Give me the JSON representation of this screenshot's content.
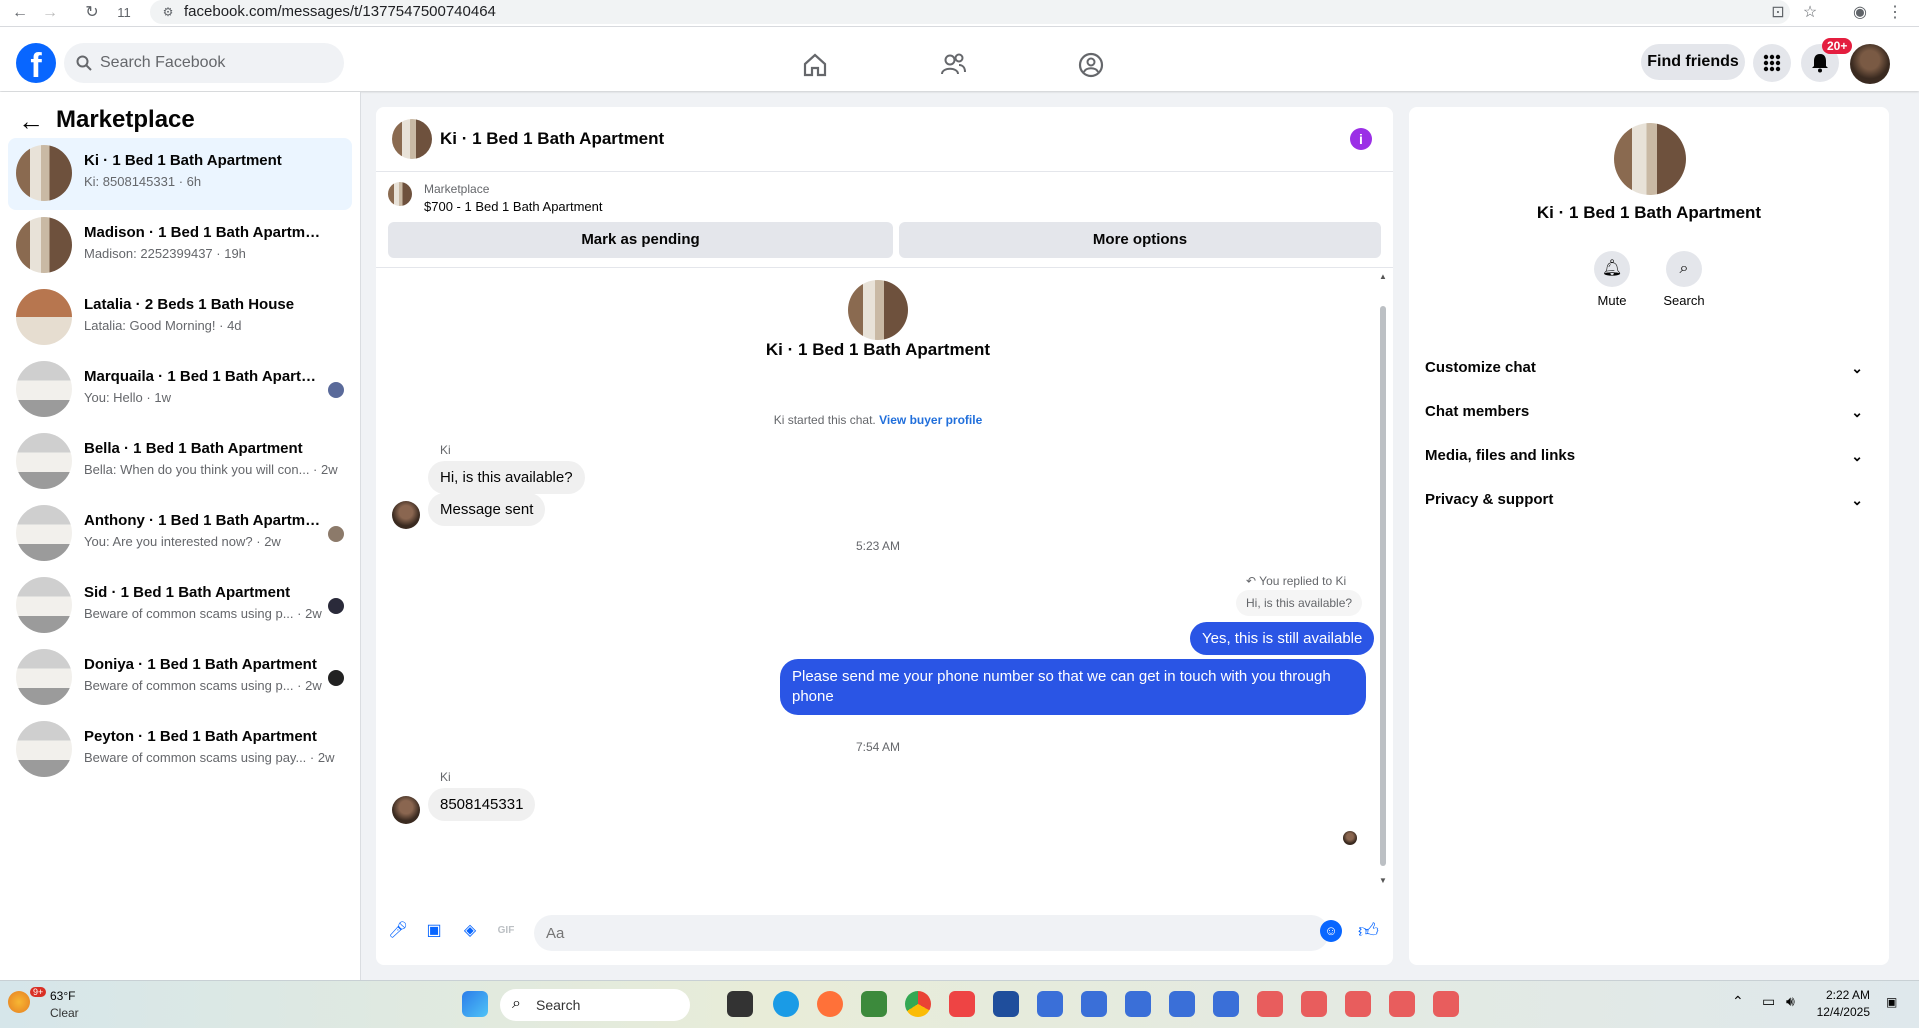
{
  "browser": {
    "tab_count": "11",
    "url": "facebook.com/messages/t/1377547500740464"
  },
  "nav": {
    "search_placeholder": "Search Facebook",
    "find_friends": "Find friends",
    "notif_badge": "20+"
  },
  "left": {
    "title": "Marketplace",
    "conversations": [
      {
        "title": "Ki · 1 Bed 1 Bath Apartment",
        "sub": "Ki: 8508145331 · 6h",
        "thumb": "apt",
        "selected": true
      },
      {
        "title": "Madison · 1 Bed 1 Bath Apartment",
        "sub": "Madison: 2252399437 · 19h",
        "thumb": "apt"
      },
      {
        "title": "Latalia · 2 Beds 1 Bath House",
        "sub": "Latalia: Good Morning! · 4d",
        "thumb": "house"
      },
      {
        "title": "Marquaila · 1 Bed 1 Bath Apartm...",
        "sub": "You: Hello · 1w",
        "thumb": "bed",
        "mini": "#5a6a9a"
      },
      {
        "title": "Bella · 1 Bed 1 Bath Apartment",
        "sub": "Bella: When do you think you will con... · 2w",
        "thumb": "bed"
      },
      {
        "title": "Anthony · 1 Bed 1 Bath Apartment",
        "sub": "You: Are you interested now? · 2w",
        "thumb": "bed",
        "mini": "#8c7a6a"
      },
      {
        "title": "Sid · 1 Bed 1 Bath Apartment",
        "sub": "Beware of common scams using p... · 2w",
        "thumb": "bed",
        "mini": "#2a2a3a"
      },
      {
        "title": "Doniya · 1 Bed 1 Bath Apartment",
        "sub": "Beware of common scams using p... · 2w",
        "thumb": "bed",
        "mini": "#222222"
      },
      {
        "title": "Peyton · 1 Bed 1 Bath Apartment",
        "sub": "Beware of common scams using pay... · 2w",
        "thumb": "bed"
      }
    ]
  },
  "chat": {
    "title": "Ki · 1 Bed 1 Bath Apartment",
    "marketplace_label": "Marketplace",
    "listing": "$700 - 1 Bed 1 Bath Apartment",
    "mark_pending": "Mark as pending",
    "more_options": "More options",
    "started_text": "Ki started this chat.",
    "view_buyer": "View buyer profile",
    "sender_name": "Ki",
    "msg1": "Hi, is this available?",
    "msg2": "Message sent",
    "time1": "5:23 AM",
    "replied_to": "You replied to Ki",
    "quoted": "Hi, is this available?",
    "out1": "Yes, this is still available",
    "out2": "Please send me your phone  number so that we can get in touch with you through phone",
    "time2": "7:54 AM",
    "msg3": "8508145331",
    "input_placeholder": "Aa"
  },
  "right": {
    "title": "Ki · 1 Bed 1 Bath Apartment",
    "mute": "Mute",
    "search": "Search",
    "items": [
      "Customize chat",
      "Chat members",
      "Media, files and links",
      "Privacy & support"
    ]
  },
  "taskbar": {
    "temp": "63°F",
    "cond": "Clear",
    "weather_badge": "9+",
    "search": "Search",
    "time": "2:22 AM",
    "date": "12/4/2025"
  }
}
